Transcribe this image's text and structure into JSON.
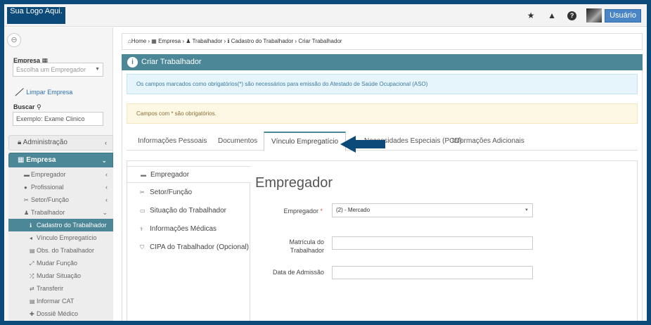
{
  "header": {
    "logo_text": "Sua Logo Aqui.",
    "user_label": "Usuário"
  },
  "sidebar": {
    "empresa_label": "Empresa",
    "empresa_placeholder": "Escolha um Empregador",
    "clear_label": "Limpar Empresa",
    "search_label": "Buscar",
    "search_value": "Exemplo: Exame Clinico",
    "groups": [
      {
        "label": "Administração"
      },
      {
        "label": "Empresa"
      }
    ],
    "items": [
      {
        "label": "Empregador"
      },
      {
        "label": "Profissional"
      },
      {
        "label": "Setor/Função"
      },
      {
        "label": "Trabalhador"
      },
      {
        "label": "Cadastro do Trabalhador"
      },
      {
        "label": "Vínculo Empregatício"
      },
      {
        "label": "Obs. do Trabalhador"
      },
      {
        "label": "Mudar Função"
      },
      {
        "label": "Mudar Situação"
      },
      {
        "label": "Transferir"
      },
      {
        "label": "Informar CAT"
      },
      {
        "label": "Dossiê Médico"
      }
    ]
  },
  "breadcrumb": {
    "home": "Home",
    "empresa": "Empresa",
    "trabalhador": "Trabalhador",
    "cadastro": "Cadastro do Trabalhador",
    "current": "Criar Trabalhador"
  },
  "panel": {
    "title": "Criar Trabalhador",
    "info_alert": "Os campos marcados como obrigatórios(*) são necessários para emissão do Atestado de Saúde Ocupacional (ASO)",
    "warn_alert": "Campos com * são obrigatórios."
  },
  "tabs": [
    {
      "label": "Informações Pessoais"
    },
    {
      "label": "Documentos"
    },
    {
      "label": "Vínculo Empregatício"
    },
    {
      "label": "Necessidades Especiais (PCD)"
    },
    {
      "label": "Informações Adicionais"
    }
  ],
  "vnav": [
    {
      "label": "Empregador"
    },
    {
      "label": "Setor/Função"
    },
    {
      "label": "Situação do Trabalhador"
    },
    {
      "label": "Informações Médicas"
    },
    {
      "label": "CIPA do Trabalhador (Opcional)"
    }
  ],
  "form": {
    "title": "Empregador",
    "empregador_label": "Empregador",
    "empregador_required": "*",
    "empregador_value": "(2) - Mercado",
    "matricula_label": "Matrícula do Trabalhador",
    "admissao_label": "Data de Admissão"
  },
  "colors": {
    "accent": "#4b8797",
    "brand": "#0c4a7a",
    "link": "#2a6fb0"
  }
}
